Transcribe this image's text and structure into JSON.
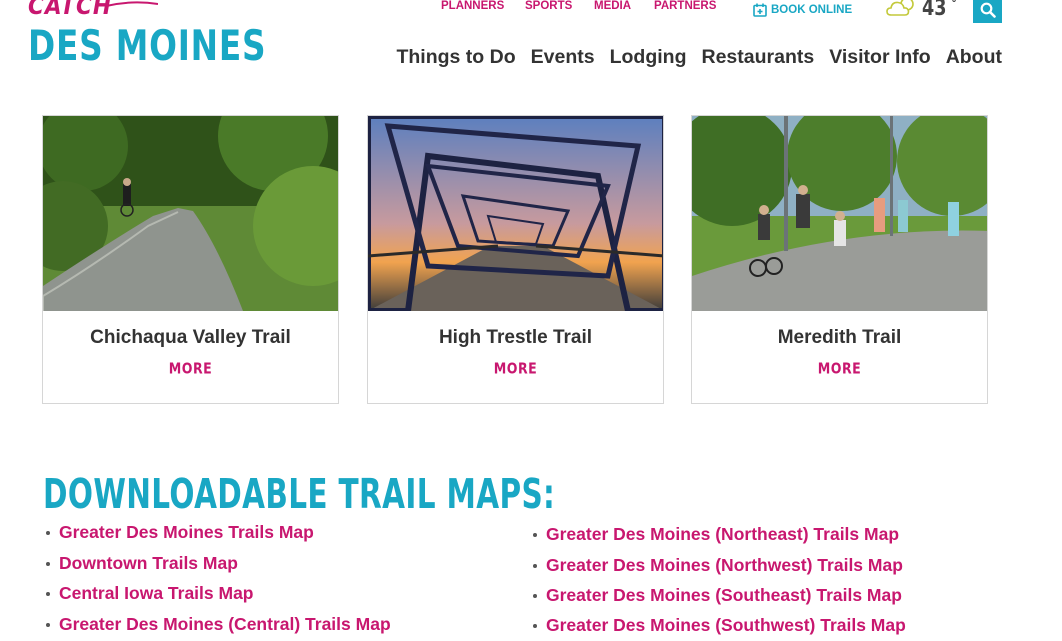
{
  "logo": {
    "catch": "CATCH",
    "city": "DES MOINES"
  },
  "util_nav": [
    "PLANNERS",
    "SPORTS",
    "MEDIA",
    "PARTNERS"
  ],
  "book_online": "BOOK ONLINE",
  "weather": {
    "temp": "43",
    "unit": "°",
    "icon": "cloud-sun-icon"
  },
  "search": {
    "icon": "search-icon"
  },
  "main_nav": [
    "Things to Do",
    "Events",
    "Lodging",
    "Restaurants",
    "Visitor Info",
    "About"
  ],
  "cards": [
    {
      "title": "Chichaqua Valley Trail",
      "more": "MORE"
    },
    {
      "title": "High Trestle Trail",
      "more": "MORE"
    },
    {
      "title": "Meredith Trail",
      "more": "MORE"
    }
  ],
  "maps": {
    "heading": "DOWNLOADABLE TRAIL MAPS:",
    "left": [
      "Greater Des Moines Trails Map",
      "Downtown Trails Map",
      "Central Iowa Trails Map",
      "Greater Des Moines (Central) Trails Map"
    ],
    "right": [
      "Greater Des Moines (Northeast) Trails Map",
      "Greater Des Moines (Northwest) Trails Map",
      "Greater Des Moines (Southeast) Trails Map",
      "Greater Des Moines (Southwest) Trails Map"
    ]
  },
  "colors": {
    "brand_pink": "#c8176f",
    "brand_teal": "#19a7c4",
    "text_dark": "#333333"
  }
}
